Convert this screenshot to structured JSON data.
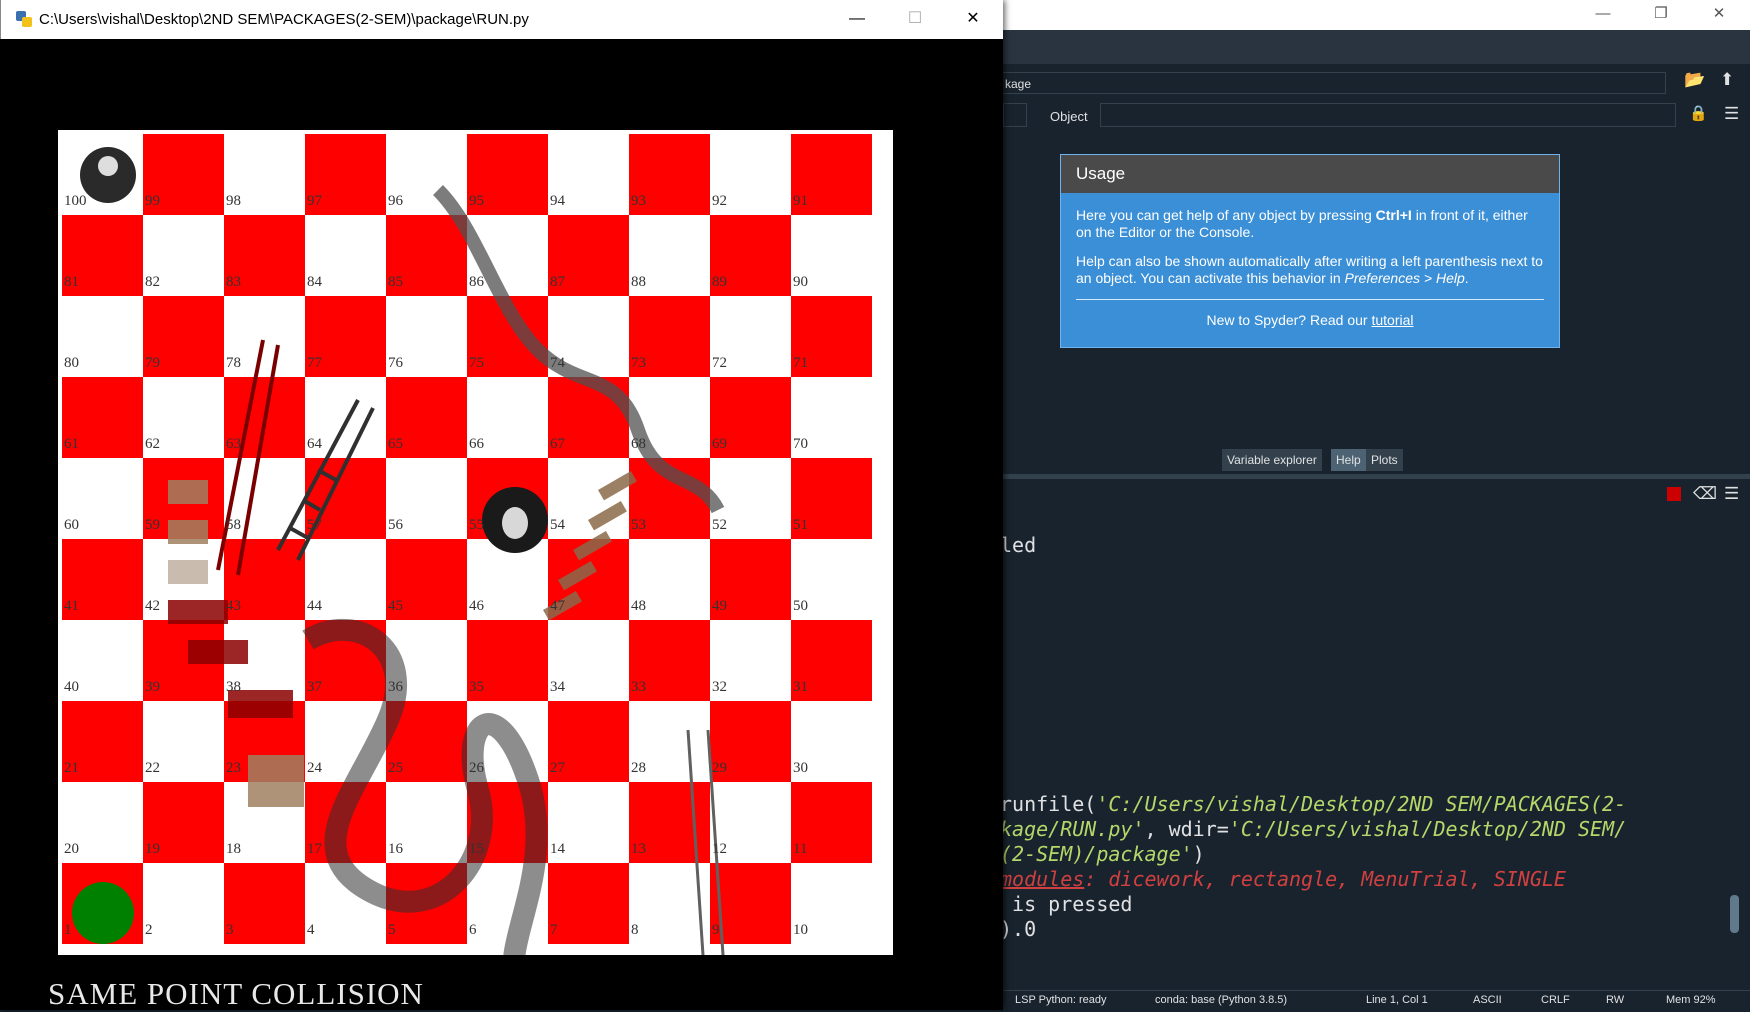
{
  "game_window": {
    "title": "C:\\Users\\vishal\\Desktop\\2ND SEM\\PACKAGES(2-SEM)\\package\\RUN.py",
    "min_icon": "—",
    "max_icon": "☐",
    "close_icon": "✕",
    "status_text": "SAME POINT COLLISION",
    "board": {
      "rows": [
        [
          100,
          99,
          98,
          97,
          96,
          95,
          94,
          93,
          92,
          91
        ],
        [
          81,
          82,
          83,
          84,
          85,
          86,
          87,
          88,
          89,
          90
        ],
        [
          80,
          79,
          78,
          77,
          76,
          75,
          74,
          73,
          72,
          71
        ],
        [
          61,
          62,
          63,
          64,
          65,
          66,
          67,
          68,
          69,
          70
        ],
        [
          60,
          59,
          58,
          57,
          56,
          55,
          54,
          53,
          52,
          51
        ],
        [
          41,
          42,
          43,
          44,
          45,
          46,
          47,
          48,
          49,
          50
        ],
        [
          40,
          39,
          38,
          37,
          36,
          35,
          34,
          33,
          32,
          31
        ],
        [
          21,
          22,
          23,
          24,
          25,
          26,
          27,
          28,
          29,
          30
        ],
        [
          20,
          19,
          18,
          17,
          16,
          15,
          14,
          13,
          12,
          11
        ],
        [
          1,
          2,
          3,
          4,
          5,
          6,
          7,
          8,
          9,
          10
        ]
      ],
      "cell_color_red": "#ff0000",
      "cell_color_white": "#ffffff",
      "player_token_color": "#008000"
    }
  },
  "spyder": {
    "path_text": "kage",
    "object_label": "Object",
    "usage": {
      "title": "Usage",
      "para1_a": "Here you can get help of any object by pressing ",
      "para1_b": "Ctrl+I",
      "para1_c": " in front of it, either on the Editor or the Console.",
      "para2_a": "Help can also be shown automatically after writing a left parenthesis next to an object. You can activate this behavior in ",
      "para2_b": "Preferences > Help",
      "para2_c": ".",
      "footer_a": "New to Spyder? Read our ",
      "footer_link": "tutorial"
    },
    "tabs": [
      "Variable explorer",
      "Help",
      "Plots"
    ],
    "console_lines": {
      "l1": "led",
      "l2": "",
      "l3": "",
      "l4": "",
      "run_a": "runfile(",
      "run_path1": "'C:/Users/vishal/Desktop/2ND SEM/PACKAGES(2-",
      "run_b": "kage/RUN.py'",
      "run_c": ", wdir=",
      "run_path2": "'C:/Users/vishal/Desktop/2ND SEM/",
      "run_d": "(2-SEM)/package'",
      "run_e": ")",
      "modules_a": "modules",
      "modules_b": ": dicework, rectangle, MenuTrial, SINGLE",
      "pressed": " is pressed",
      "zero": ").0"
    },
    "status": {
      "lsp": "LSP Python: ready",
      "conda": "conda: base (Python 3.8.5)",
      "pos": "Line 1, Col 1",
      "enc": "ASCII",
      "eol": "CRLF",
      "rw": "RW",
      "mem": "Mem 92%"
    }
  }
}
